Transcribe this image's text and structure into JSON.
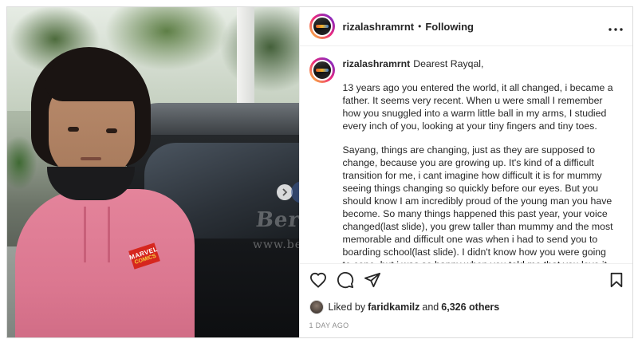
{
  "header": {
    "username": "rizalashramrnt",
    "separator": "•",
    "follow_status": "Following",
    "more_icon": "more-horizontal-icon"
  },
  "watermark": {
    "brand": "Berita Kopi",
    "url": "www.beritakopi"
  },
  "photo": {
    "shirt_logo_top": "MARVEL",
    "shirt_logo_bottom": "COMICS"
  },
  "caption": {
    "username": "rizalashramrnt",
    "greeting": "Dearest Rayqal,",
    "paragraphs": [
      "13 years ago you entered the world, it all changed, i became a father. It seems very recent. When u were small I remember how you snuggled into a warm little ball in my arms, I studied every inch of you, looking at your tiny fingers and tiny toes.",
      "Sayang, things are changing, just as they are supposed to change, because you are growing up. It's kind of a difficult transition for me, i cant imagine how difficult it is for mummy seeing things changing so quickly before our eyes. But you should know I am incredibly proud of the young man you have become. So many things happened this past year, your voice changed(last slide), you grew taller than mummy and the most memorable and difficult one was when i had to send you to boarding school(last slide). I didn't know how you were going to cope, but i was so happy when you told me that you love it over there. I hope it keeps on that way, i will always be here for you."
    ]
  },
  "likes": {
    "prefix": "Liked by",
    "user": "faridkamilz",
    "conjunction": "and",
    "others": "6,326 others"
  },
  "timestamp": "1 DAY AGO",
  "colors": {
    "text": "#262626",
    "muted": "#8e8e8e",
    "border": "#dbdbdb",
    "hoodie": "#e4849b"
  }
}
